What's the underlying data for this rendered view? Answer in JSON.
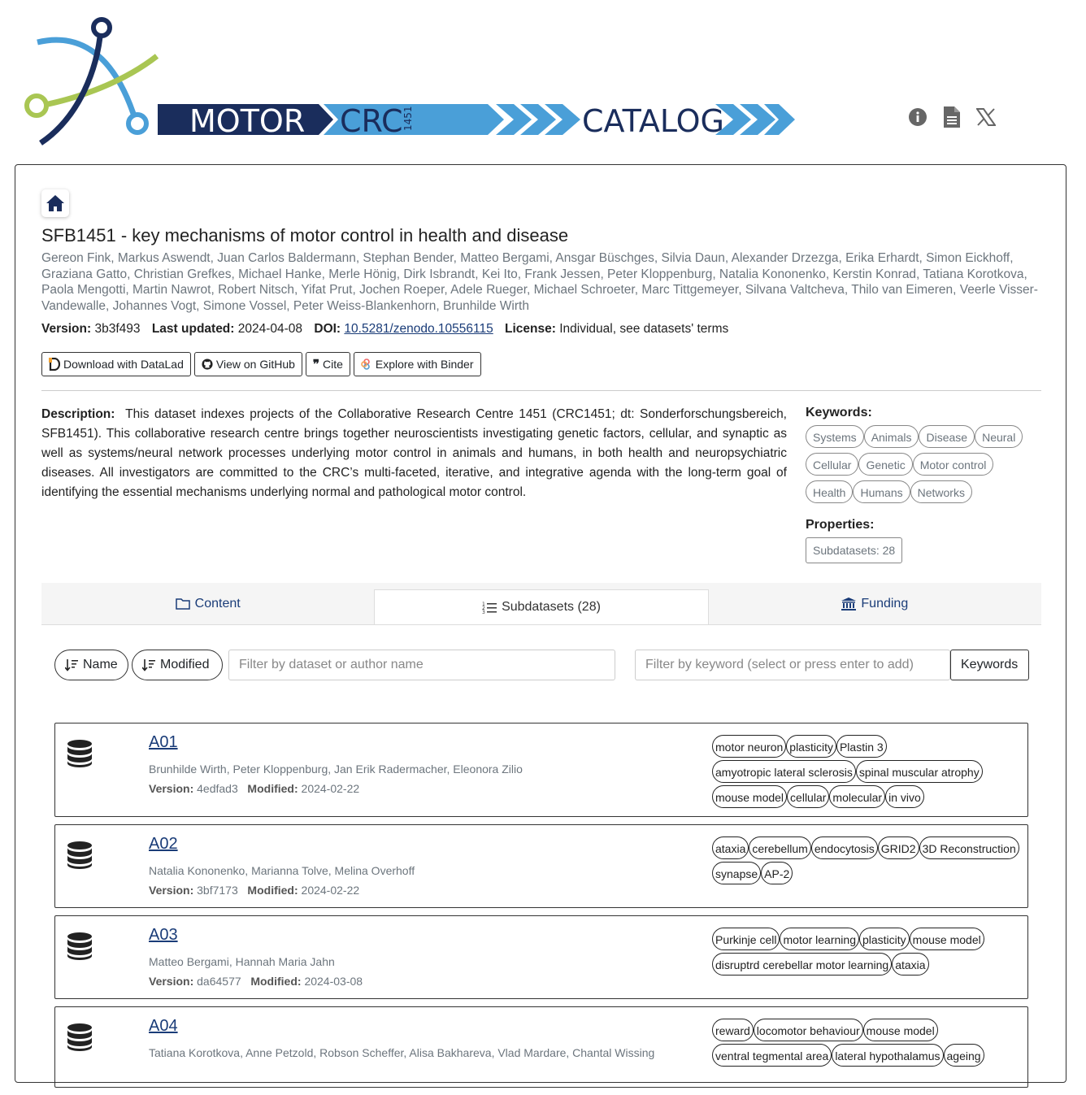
{
  "logo": {
    "motor": "MOTOR",
    "crc": "CRC",
    "num": "1451",
    "catalog": "CATALOG"
  },
  "header_icons": [
    "info-icon",
    "document-icon",
    "x-icon"
  ],
  "title": "SFB1451 - key mechanisms of motor control in health and disease",
  "authors": "Gereon Fink, Markus Aswendt, Juan Carlos Baldermann, Stephan Bender, Matteo Bergami, Ansgar Büschges, Silvia Daun, Alexander Drzezga, Erika Erhardt, Simon Eickhoff, Graziana Gatto, Christian Grefkes, Michael Hanke, Merle Hönig, Dirk Isbrandt, Kei Ito, Frank Jessen, Peter Kloppenburg, Natalia Kononenko, Kerstin Konrad, Tatiana Korotkova, Paola Mengotti, Martin Nawrot, Robert Nitsch, Yifat Prut, Jochen Roeper, Adele Rueger, Michael Schroeter, Marc Tittgemeyer, Silvana Valtcheva, Thilo van Eimeren, Veerle Visser-Vandewalle, Johannes Vogt, Simone Vossel, Peter Weiss-Blankenhorn, Brunhilde Wirth",
  "meta": {
    "version_label": "Version:",
    "version": "3b3f493",
    "updated_label": "Last updated:",
    "updated": "2024-04-08",
    "doi_label": "DOI:",
    "doi": "10.5281/zenodo.10556115",
    "license_label": "License:",
    "license": "Individual, see datasets' terms"
  },
  "buttons": {
    "datalad": "Download with DataLad",
    "github": "View on GitHub",
    "cite": "Cite",
    "binder": "Explore with Binder"
  },
  "description": {
    "label": "Description:",
    "text": "This dataset indexes projects of the Collaborative Research Centre 1451 (CRC1451; dt: Sonderforschungsbereich, SFB1451). This collaborative research centre brings together neuroscientists investigating genetic factors, cellular, and synaptic as well as systems/neural network processes underlying motor control in animals and humans, in both health and neuropsychiatric diseases. All investigators are committed to the CRC’s multi-faceted, iterative, and integrative agenda with the long-term goal of identifying the essential mechanisms underlying normal and pathological motor control."
  },
  "keywords_label": "Keywords:",
  "keywords": [
    "Systems",
    "Animals",
    "Disease",
    "Neural",
    "Cellular",
    "Genetic",
    "Motor control",
    "Health",
    "Humans",
    "Networks"
  ],
  "properties_label": "Properties:",
  "properties": [
    "Subdatasets: 28"
  ],
  "tabs": [
    {
      "label": "Content"
    },
    {
      "label": "Subdatasets (28)"
    },
    {
      "label": "Funding"
    }
  ],
  "filters": {
    "sort_name": "Name",
    "sort_modified": "Modified",
    "name_placeholder": "Filter by dataset or author name",
    "kw_placeholder": "Filter by keyword (select or press enter to add)",
    "kw_button": "Keywords"
  },
  "subdatasets": [
    {
      "name": "A01",
      "authors": "Brunhilde Wirth, Peter Kloppenburg, Jan Erik Radermacher, Eleonora Zilio",
      "version": "4edfad3",
      "modified": "2024-02-22",
      "tags": [
        "motor neuron",
        "plasticity",
        "Plastin 3",
        "amyotropic lateral sclerosis",
        "spinal muscular atrophy",
        "mouse model",
        "cellular",
        "molecular",
        "in vivo"
      ]
    },
    {
      "name": "A02",
      "authors": "Natalia Kononenko, Marianna Tolve, Melina Overhoff",
      "version": "3bf7173",
      "modified": "2024-02-22",
      "tags": [
        "ataxia",
        "cerebellum",
        "endocytosis",
        "GRID2",
        "3D Reconstruction",
        "synapse",
        "AP-2"
      ]
    },
    {
      "name": "A03",
      "authors": "Matteo Bergami, Hannah Maria Jahn",
      "version": "da64577",
      "modified": "2024-03-08",
      "tags": [
        "Purkinje cell",
        "motor learning",
        "plasticity",
        "mouse model",
        "disruptrd cerebellar motor learning",
        "ataxia"
      ]
    },
    {
      "name": "A04",
      "authors": "Tatiana Korotkova, Anne Petzold, Robson Scheffer, Alisa Bakhareva, Vlad Mardare, Chantal Wissing",
      "version": "",
      "modified": "",
      "tags": [
        "reward",
        "locomotor behaviour",
        "mouse model",
        "ventral tegmental area",
        "lateral hypothalamus",
        "ageing"
      ]
    }
  ],
  "labels": {
    "version": "Version:",
    "modified": "Modified:"
  }
}
